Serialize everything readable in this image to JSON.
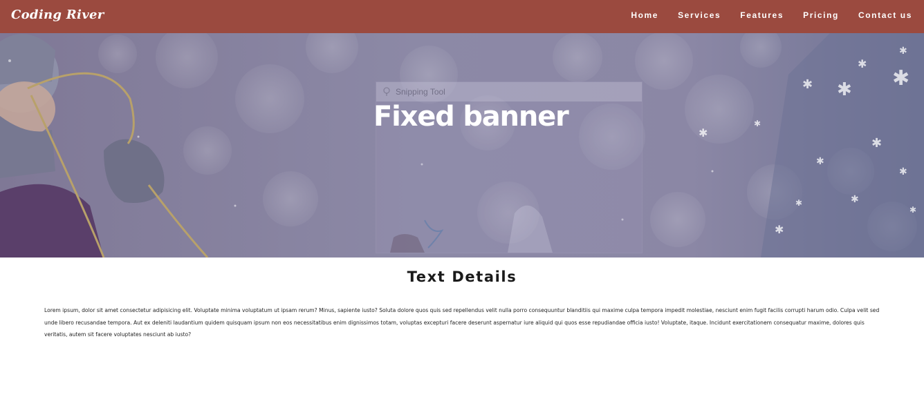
{
  "navbar": {
    "brand": "Coding River",
    "links": [
      "Home",
      "Services",
      "Features",
      "Pricing",
      "Contact us"
    ]
  },
  "banner": {
    "title": "Fixed banner",
    "overlay_window_title": "Snipping Tool"
  },
  "section": {
    "heading": "Text Details",
    "paragraph": "Lorem ipsum, dolor sit amet consectetur adipisicing elit. Voluptate minima voluptatum ut ipsam rerum? Minus, sapiente iusto? Soluta dolore quos quis sed repellendus velit nulla porro consequuntur blanditiis qui maxime culpa tempora impedit molestiae, nesciunt enim fugit facilis corrupti harum odio. Culpa velit sed unde libero recusandae tempora. Aut ex deleniti laudantium quidem quisquam ipsum non eos necessitatibus enim dignissimos totam, voluptas excepturi facere deserunt aspernatur iure aliquid qui quos esse repudiandae officia iusto! Voluptate, itaque. Incidunt exercitationem consequatur maxime, dolores quis veritatis, autem sit facere voluptates nesciunt ab iusto?"
  },
  "colors": {
    "navbar": "#9b4a3f",
    "banner_overlay": "#86839e",
    "text": "#222222"
  }
}
